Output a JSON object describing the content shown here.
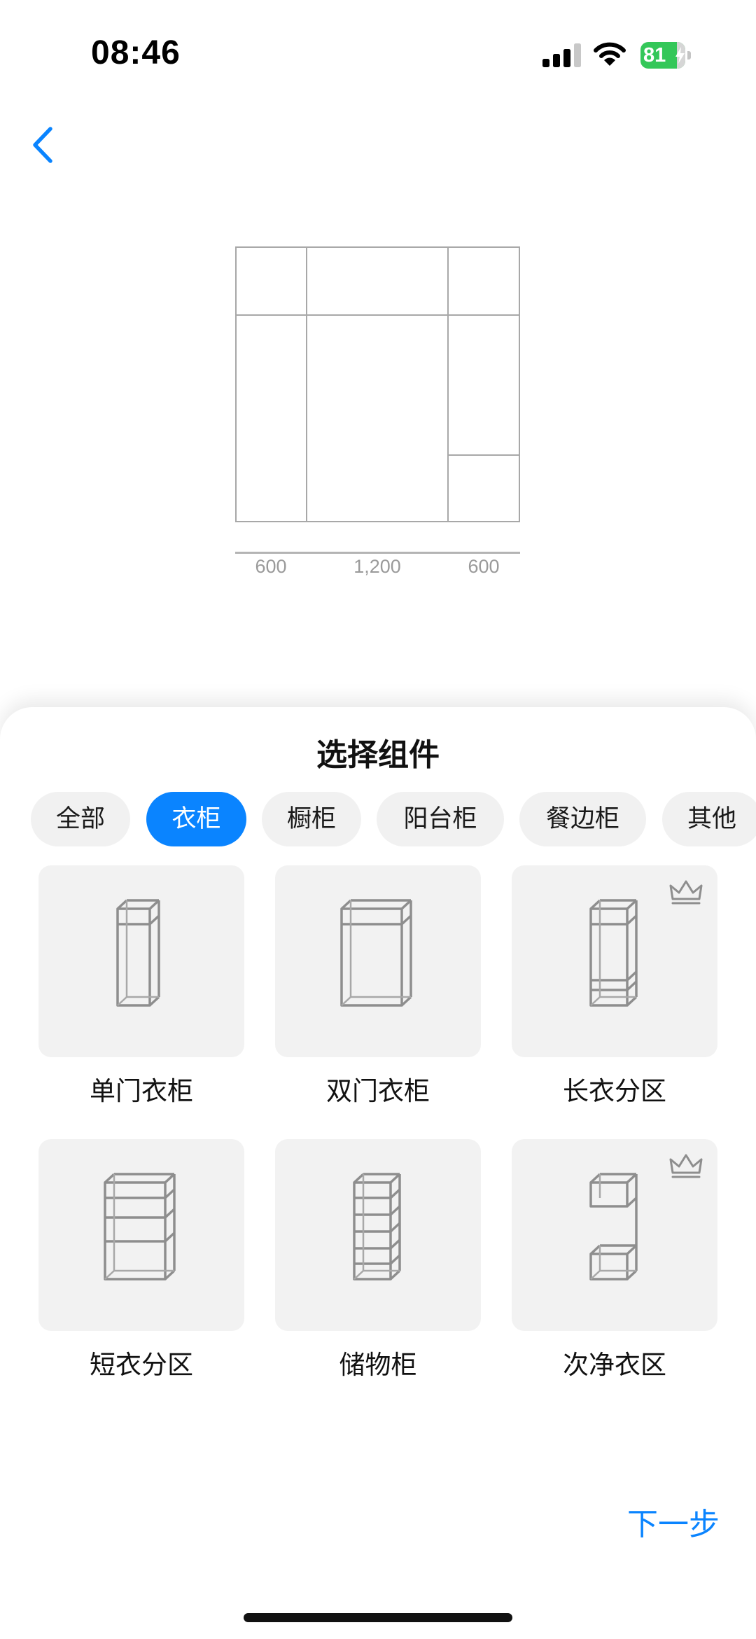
{
  "status_bar": {
    "time": "08:46",
    "battery_percent": "81",
    "battery_level": 0.81,
    "battery_color": "#34c759"
  },
  "nav": {
    "back_icon": "chevron-left-icon",
    "accent_color": "#0a84ff"
  },
  "preview": {
    "dimensions": [
      "600",
      "1,200",
      "600"
    ]
  },
  "sheet": {
    "title": "选择组件",
    "tabs": [
      {
        "label": "全部",
        "active": false
      },
      {
        "label": "衣柜",
        "active": true
      },
      {
        "label": "橱柜",
        "active": false
      },
      {
        "label": "阳台柜",
        "active": false
      },
      {
        "label": "餐边柜",
        "active": false
      },
      {
        "label": "其他",
        "active": false
      }
    ],
    "items": [
      {
        "label": "单门衣柜",
        "icon": "single-door-wardrobe-icon",
        "premium": false
      },
      {
        "label": "双门衣柜",
        "icon": "double-door-wardrobe-icon",
        "premium": false
      },
      {
        "label": "长衣分区",
        "icon": "long-clothes-section-icon",
        "premium": true
      },
      {
        "label": "短衣分区",
        "icon": "short-clothes-section-icon",
        "premium": false
      },
      {
        "label": "储物柜",
        "icon": "storage-cabinet-icon",
        "premium": false
      },
      {
        "label": "次净衣区",
        "icon": "worn-clothes-section-icon",
        "premium": true
      }
    ],
    "premium_icon": "crown-icon",
    "next_label": "下一步"
  }
}
